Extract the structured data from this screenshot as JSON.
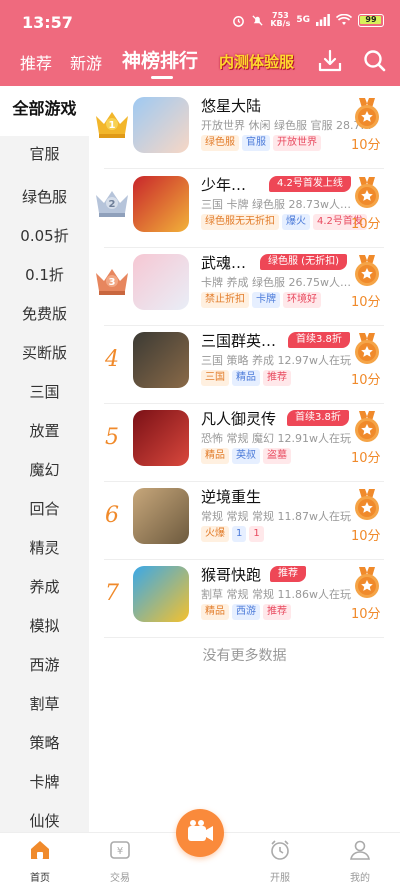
{
  "status_bar": {
    "time": "13:57",
    "speed_value": "753",
    "speed_unit": "KB/s",
    "network": "5G",
    "battery": "99"
  },
  "top_nav": {
    "tabs": [
      {
        "label": "推荐",
        "active": false
      },
      {
        "label": "新游",
        "active": false
      },
      {
        "label": "神榜排行",
        "active": true
      }
    ],
    "promo_label": "内测体验服",
    "icons": [
      "download-icon",
      "search-icon"
    ]
  },
  "sidebar": {
    "items": [
      "全部游戏",
      "官服",
      "绿色服",
      "0.05折",
      "0.1折",
      "免费版",
      "买断版",
      "三国",
      "放置",
      "魔幻",
      "回合",
      "精灵",
      "养成",
      "模拟",
      "西游",
      "割草",
      "策略",
      "卡牌",
      "仙侠"
    ],
    "active_index": 0
  },
  "games": [
    {
      "rank": "1",
      "title": "悠星大陆",
      "badge": "",
      "meta": "开放世界  休闲  绿色服  官服  28.7…",
      "tags": [
        {
          "t": "绿色服",
          "c": "orange"
        },
        {
          "t": "官服",
          "c": "blue"
        },
        {
          "t": "开放世界",
          "c": "red"
        }
      ],
      "score": "10分",
      "thumb_colors": [
        "#9ec9f2",
        "#f7d7c5"
      ]
    },
    {
      "rank": "2",
      "title": "少年…",
      "badge": "4.2号首发上线",
      "meta": "三国  卡牌  绿色服  28.73w人…",
      "tags": [
        {
          "t": "绿色服无无折扣",
          "c": "orange"
        },
        {
          "t": "爆火",
          "c": "blue"
        },
        {
          "t": "4.2号首发",
          "c": "red"
        }
      ],
      "score": "10分",
      "thumb_colors": [
        "#c8262b",
        "#f2b23a"
      ]
    },
    {
      "rank": "3",
      "title": "武魂…",
      "badge": "绿色服 (无折扣)",
      "meta": "卡牌  养成  绿色服  26.75w人…",
      "tags": [
        {
          "t": "禁止折扣",
          "c": "orange"
        },
        {
          "t": "卡牌",
          "c": "blue"
        },
        {
          "t": "环境好",
          "c": "red"
        }
      ],
      "score": "10分",
      "thumb_colors": [
        "#f6c7d3",
        "#e9eef7"
      ]
    },
    {
      "rank": "4",
      "title": "三国群英…",
      "badge": "首续3.8折",
      "meta": "三国  策略  养成  12.97w人在玩",
      "tags": [
        {
          "t": "三国",
          "c": "orange"
        },
        {
          "t": "精品",
          "c": "blue"
        },
        {
          "t": "推荐",
          "c": "red"
        }
      ],
      "score": "10分",
      "thumb_colors": [
        "#3b3a34",
        "#8a6a48"
      ]
    },
    {
      "rank": "5",
      "title": "凡人御灵传",
      "badge": "首续3.8折",
      "meta": "恐怖  常规  魔幻  12.91w人在玩",
      "tags": [
        {
          "t": "精品",
          "c": "orange"
        },
        {
          "t": "英叔",
          "c": "blue"
        },
        {
          "t": "盗墓",
          "c": "red"
        }
      ],
      "score": "10分",
      "thumb_colors": [
        "#7a1016",
        "#d9483d"
      ]
    },
    {
      "rank": "6",
      "title": "逆境重生",
      "badge": "",
      "meta": "常规  常规  常规  11.87w人在玩",
      "tags": [
        {
          "t": "火爆",
          "c": "orange"
        },
        {
          "t": "1",
          "c": "blue"
        },
        {
          "t": "1",
          "c": "red"
        }
      ],
      "score": "10分",
      "thumb_colors": [
        "#c7a77b",
        "#6d5a3e"
      ]
    },
    {
      "rank": "7",
      "title": "猴哥快跑",
      "badge": "推荐",
      "meta": "割草  常规  常规  11.86w人在玩",
      "tags": [
        {
          "t": "精品",
          "c": "orange"
        },
        {
          "t": "西游",
          "c": "blue"
        },
        {
          "t": "推荐",
          "c": "red"
        }
      ],
      "score": "10分",
      "thumb_colors": [
        "#3aa8e8",
        "#f4c12e"
      ]
    }
  ],
  "no_more": "没有更多数据",
  "tabbar": [
    {
      "label": "首页",
      "icon": "home-icon",
      "active": true
    },
    {
      "label": "交易",
      "icon": "trade-icon",
      "active": false
    },
    {
      "label": "",
      "icon": "video-icon",
      "active": false
    },
    {
      "label": "开服",
      "icon": "alarm-clock-icon",
      "active": false
    },
    {
      "label": "我的",
      "icon": "user-icon",
      "active": false
    }
  ],
  "colors": {
    "brand": "#ef6a7e",
    "accent": "#f08a2b",
    "badge": "#ee4756"
  }
}
